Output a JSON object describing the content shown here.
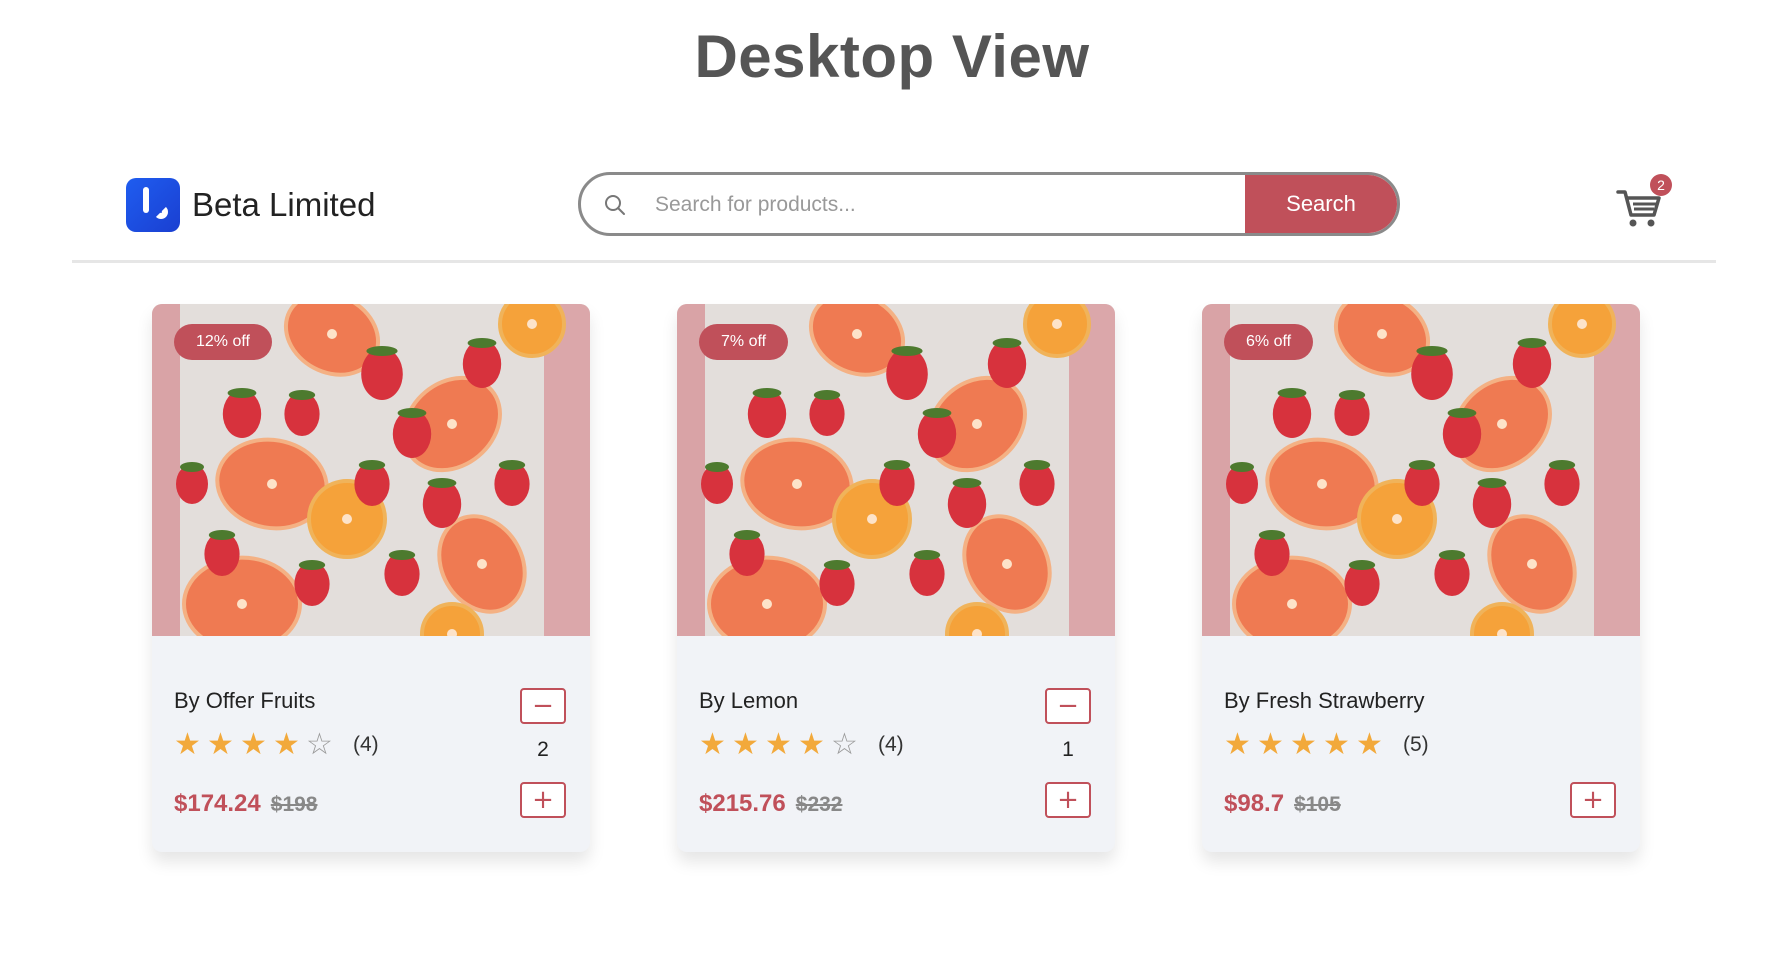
{
  "page": {
    "title": "Desktop View"
  },
  "header": {
    "brand": "Beta Limited",
    "search": {
      "placeholder": "Search for products...",
      "value": "",
      "button_label": "Search"
    },
    "cart": {
      "count": "2"
    }
  },
  "products": [
    {
      "discount": "12% off",
      "name": "By Offer Fruits",
      "rating": 4,
      "rating_count": "(4)",
      "price": "$174.24",
      "old_price": "$198",
      "quantity": "2",
      "minus_label": "−",
      "plus_label": "+"
    },
    {
      "discount": "7% off",
      "name": "By Lemon",
      "rating": 4,
      "rating_count": "(4)",
      "price": "$215.76",
      "old_price": "$232",
      "quantity": "1",
      "minus_label": "−",
      "plus_label": "+"
    },
    {
      "discount": "6% off",
      "name": "By Fresh Strawberry",
      "rating": 5,
      "rating_count": "(5)",
      "price": "$98.7",
      "old_price": "$105",
      "quantity": "",
      "minus_label": "",
      "plus_label": "+"
    }
  ],
  "colors": {
    "accent": "#c0505a",
    "star": "#f2a93b",
    "card_bg": "#f1f3f7"
  },
  "icons": {
    "search": "search-icon",
    "cart": "cart-icon",
    "star": "star-icon",
    "logo": "brand-logo-icon"
  }
}
